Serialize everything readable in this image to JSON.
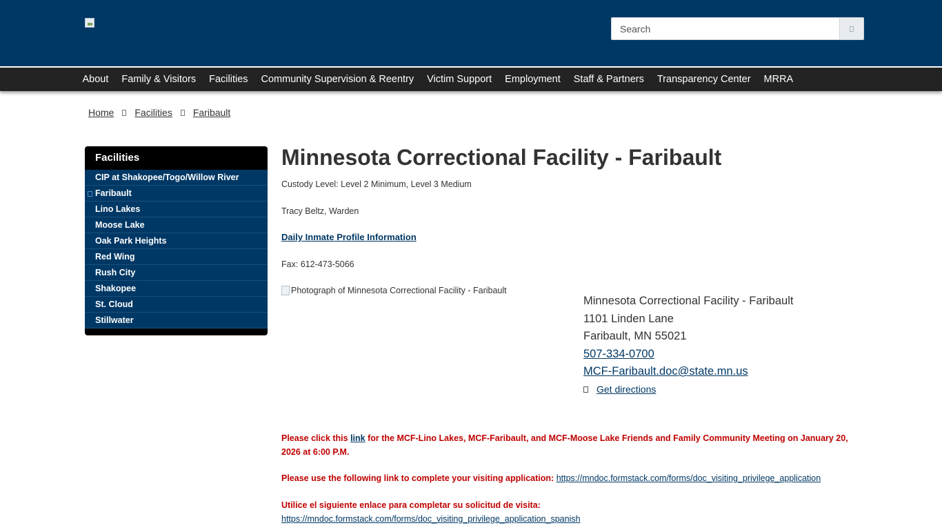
{
  "header": {
    "logo_alt": "",
    "search": {
      "placeholder": "Search"
    }
  },
  "nav": {
    "items": [
      "About",
      "Family & Visitors",
      "Facilities",
      "Community Supervision & Reentry",
      "Victim Support",
      "Employment",
      "Staff & Partners",
      "Transparency Center",
      "MRRA"
    ]
  },
  "breadcrumb": [
    "Home",
    "Facilities",
    "Faribault"
  ],
  "sidebar": {
    "title": "Facilities",
    "items": [
      "CIP at Shakopee/Togo/Willow River",
      "Faribault",
      "Lino Lakes",
      "Moose Lake",
      "Oak Park Heights",
      "Red Wing",
      "Rush City",
      "Shakopee",
      "St. Cloud",
      "Stillwater"
    ],
    "active": "Faribault"
  },
  "main": {
    "title": "Minnesota Correctional Facility - Faribault",
    "custody": "Custody Level: Level 2 Minimum, Level 3 Medium",
    "warden": "Tracy Beltz, Warden",
    "profile_link": "Daily Inmate Profile Information",
    "fax": "Fax: 612-473-5066",
    "photo_alt": "Photograph of Minnesota Correctional Facility - Faribault",
    "address": {
      "name": "Minnesota Correctional Facility - Faribault",
      "street": "1101 Linden Lane",
      "city": "Faribault, MN 55021",
      "phone": "507-334-0700",
      "email": "MCF-Faribault.doc@state.mn.us",
      "directions": "Get directions"
    },
    "notice1": {
      "before": "Please click this ",
      "link": "link",
      "after": " for the MCF-Lino Lakes, MCF-Faribault, and MCF-Moose Lake Friends and Family Community Meeting on January 20, 2026 at 6:00 P.M."
    },
    "notice2": {
      "text": "Please use the following link to complete your visiting application: ",
      "link": "https://mndoc.formstack.com/forms/doc_visiting_privilege_application"
    },
    "notice3": {
      "text": "Utilice el siguiente enlace para completar su solicitud de visita: ",
      "link": "https://mndoc.formstack.com/forms/doc_visiting_privilege_application_spanish"
    }
  },
  "colors": {
    "brand_blue": "#003865",
    "nav_bg": "#232323",
    "notice_red": "#c00000"
  }
}
